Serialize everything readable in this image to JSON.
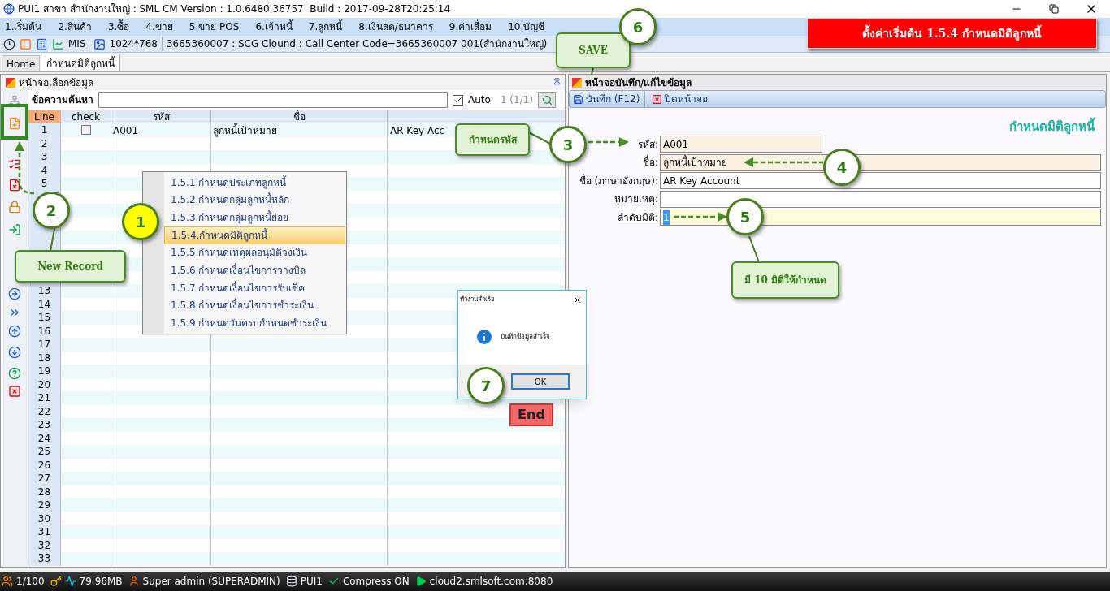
{
  "window": {
    "title": "PUI1 สาขา สำนักงานใหญ่ : SML CM Version : 1.0.6480.36757  Build : 2017-09-28T20:25:14"
  },
  "menu": [
    "1.เริ่มต้น",
    "2.สินค้า",
    "3.ซื้อ",
    "4.ขาย",
    "5.ขาย POS",
    "6.เจ้าหนี้",
    "7.ลูกหนี้",
    "8.เงินสด/ธนาคาร",
    "9.ค่าเสื่อม",
    "10.บัญชี"
  ],
  "toolbar": {
    "mis": "MIS",
    "resolution": "1024*768",
    "info": "3665360007 : SCG Clound : Call Center Code=3665360007 001(สำนักงานใหญ่)"
  },
  "tabs": [
    {
      "label": "Home",
      "selected": false
    },
    {
      "label": "กำหนดมิติลูกหนี้",
      "selected": true
    }
  ],
  "left_panel": {
    "title": "หน้าจอเลือกข้อมูล",
    "search_label": "ข้อความค้นหา",
    "auto": {
      "label": "Auto",
      "checked": true
    },
    "count": "1 (1/1)",
    "columns": [
      "Line",
      "check",
      "รหัส",
      "ชื่อ"
    ],
    "rows": [
      {
        "line": "1",
        "checked": false,
        "code": "A001",
        "name": "ลูกหนี้เป้าหมาย",
        "name_en": "AR Key Acc"
      },
      {
        "line": "2"
      },
      {
        "line": "3"
      },
      {
        "line": "4"
      },
      {
        "line": "5"
      },
      {},
      {},
      {},
      {},
      {},
      {},
      {},
      {
        "line": "13"
      },
      {
        "line": "14"
      },
      {
        "line": "15"
      },
      {
        "line": "16"
      },
      {
        "line": "17"
      },
      {
        "line": "18"
      },
      {
        "line": "19"
      },
      {
        "line": "20"
      },
      {
        "line": "21"
      },
      {
        "line": "22"
      },
      {
        "line": "23"
      },
      {
        "line": "24"
      },
      {
        "line": "25"
      },
      {
        "line": "26"
      },
      {
        "line": "27"
      },
      {
        "line": "28"
      },
      {
        "line": "29"
      },
      {
        "line": "30"
      },
      {
        "line": "31"
      },
      {
        "line": "32"
      },
      {
        "line": "33"
      }
    ]
  },
  "popup_menu": [
    {
      "label": "1.5.1.กำหนดประเภทลูกหนี้",
      "selected": false
    },
    {
      "label": "1.5.2.กำหนดกลุ่มลูกหนี้หลัก",
      "selected": false
    },
    {
      "label": "1.5.3.กำหนดกลุ่มลูกหนี้ย่อย",
      "selected": false
    },
    {
      "label": "1.5.4.กำหนดมิติลูกหนี้",
      "selected": true
    },
    {
      "label": "1.5.5.กำหนดเหตุผลอนุมัติวงเงิน",
      "selected": false
    },
    {
      "label": "1.5.6.กำหนดเงื่อนไขการวางบิล",
      "selected": false
    },
    {
      "label": "1.5.7.กำหนดเงื่อนไขการรับเช็ค",
      "selected": false
    },
    {
      "label": "1.5.8.กำหนดเงื่อนไขการชำระเงิน",
      "selected": false
    },
    {
      "label": "1.5.9.กำหนดวันครบกำหนดชำระเงิน",
      "selected": false
    }
  ],
  "right_panel": {
    "title": "หน้าจอบันทึก/แก้ไขข้อมูล",
    "toolbar": [
      {
        "kind": "save",
        "label": "บันทึก (F12)"
      },
      {
        "kind": "close",
        "label": "ปิดหน้าจอ"
      }
    ],
    "form_title": "กำหนดมิติลูกหนี้",
    "fields": [
      {
        "kind": "code",
        "label": "รหัส:",
        "value": "A001"
      },
      {
        "kind": "required",
        "label": "ชื่อ:",
        "value": "ลูกหนี้เป้าหมาย"
      },
      {
        "kind": "plain",
        "label": "ชื่อ (ภาษาอังกฤษ):",
        "value": "AR Key Account"
      },
      {
        "kind": "plain",
        "label": "หมายเหตุ:"
      },
      {
        "kind": "focused",
        "label": "ลำดับมิติ:",
        "value": "1",
        "text_selected": true
      }
    ]
  },
  "dialog": {
    "title": "ทำงานสำเร็จ",
    "message": "บันทึกข้อมูลสำเร็จ",
    "button": "OK"
  },
  "end_button": "End",
  "banner": "ตั้งค่าเริ่มต้น 1.5.4 กำหนดมิติลูกหนี้",
  "steps": [
    {
      "label": "1",
      "color": "#ffff00"
    },
    {
      "label": "2",
      "color": "#ffffff"
    },
    {
      "label": "3",
      "color": "#ffffff"
    },
    {
      "label": "4",
      "color": "#ffffff"
    },
    {
      "label": "5",
      "color": "#ffffff"
    },
    {
      "label": "6",
      "color": "#ffffff"
    },
    {
      "label": "7",
      "color": "#ffffff"
    }
  ],
  "notes": [
    "New Record",
    "กำหนดรหัส",
    "มี 10 มิติให้กำหนด",
    "SAVE"
  ],
  "status_bar": [
    "1/100",
    "79.96MB",
    "Super admin (SUPERADMIN)",
    "PUI1",
    "Compress ON",
    "cloud2.smlsoft.com:8080"
  ]
}
